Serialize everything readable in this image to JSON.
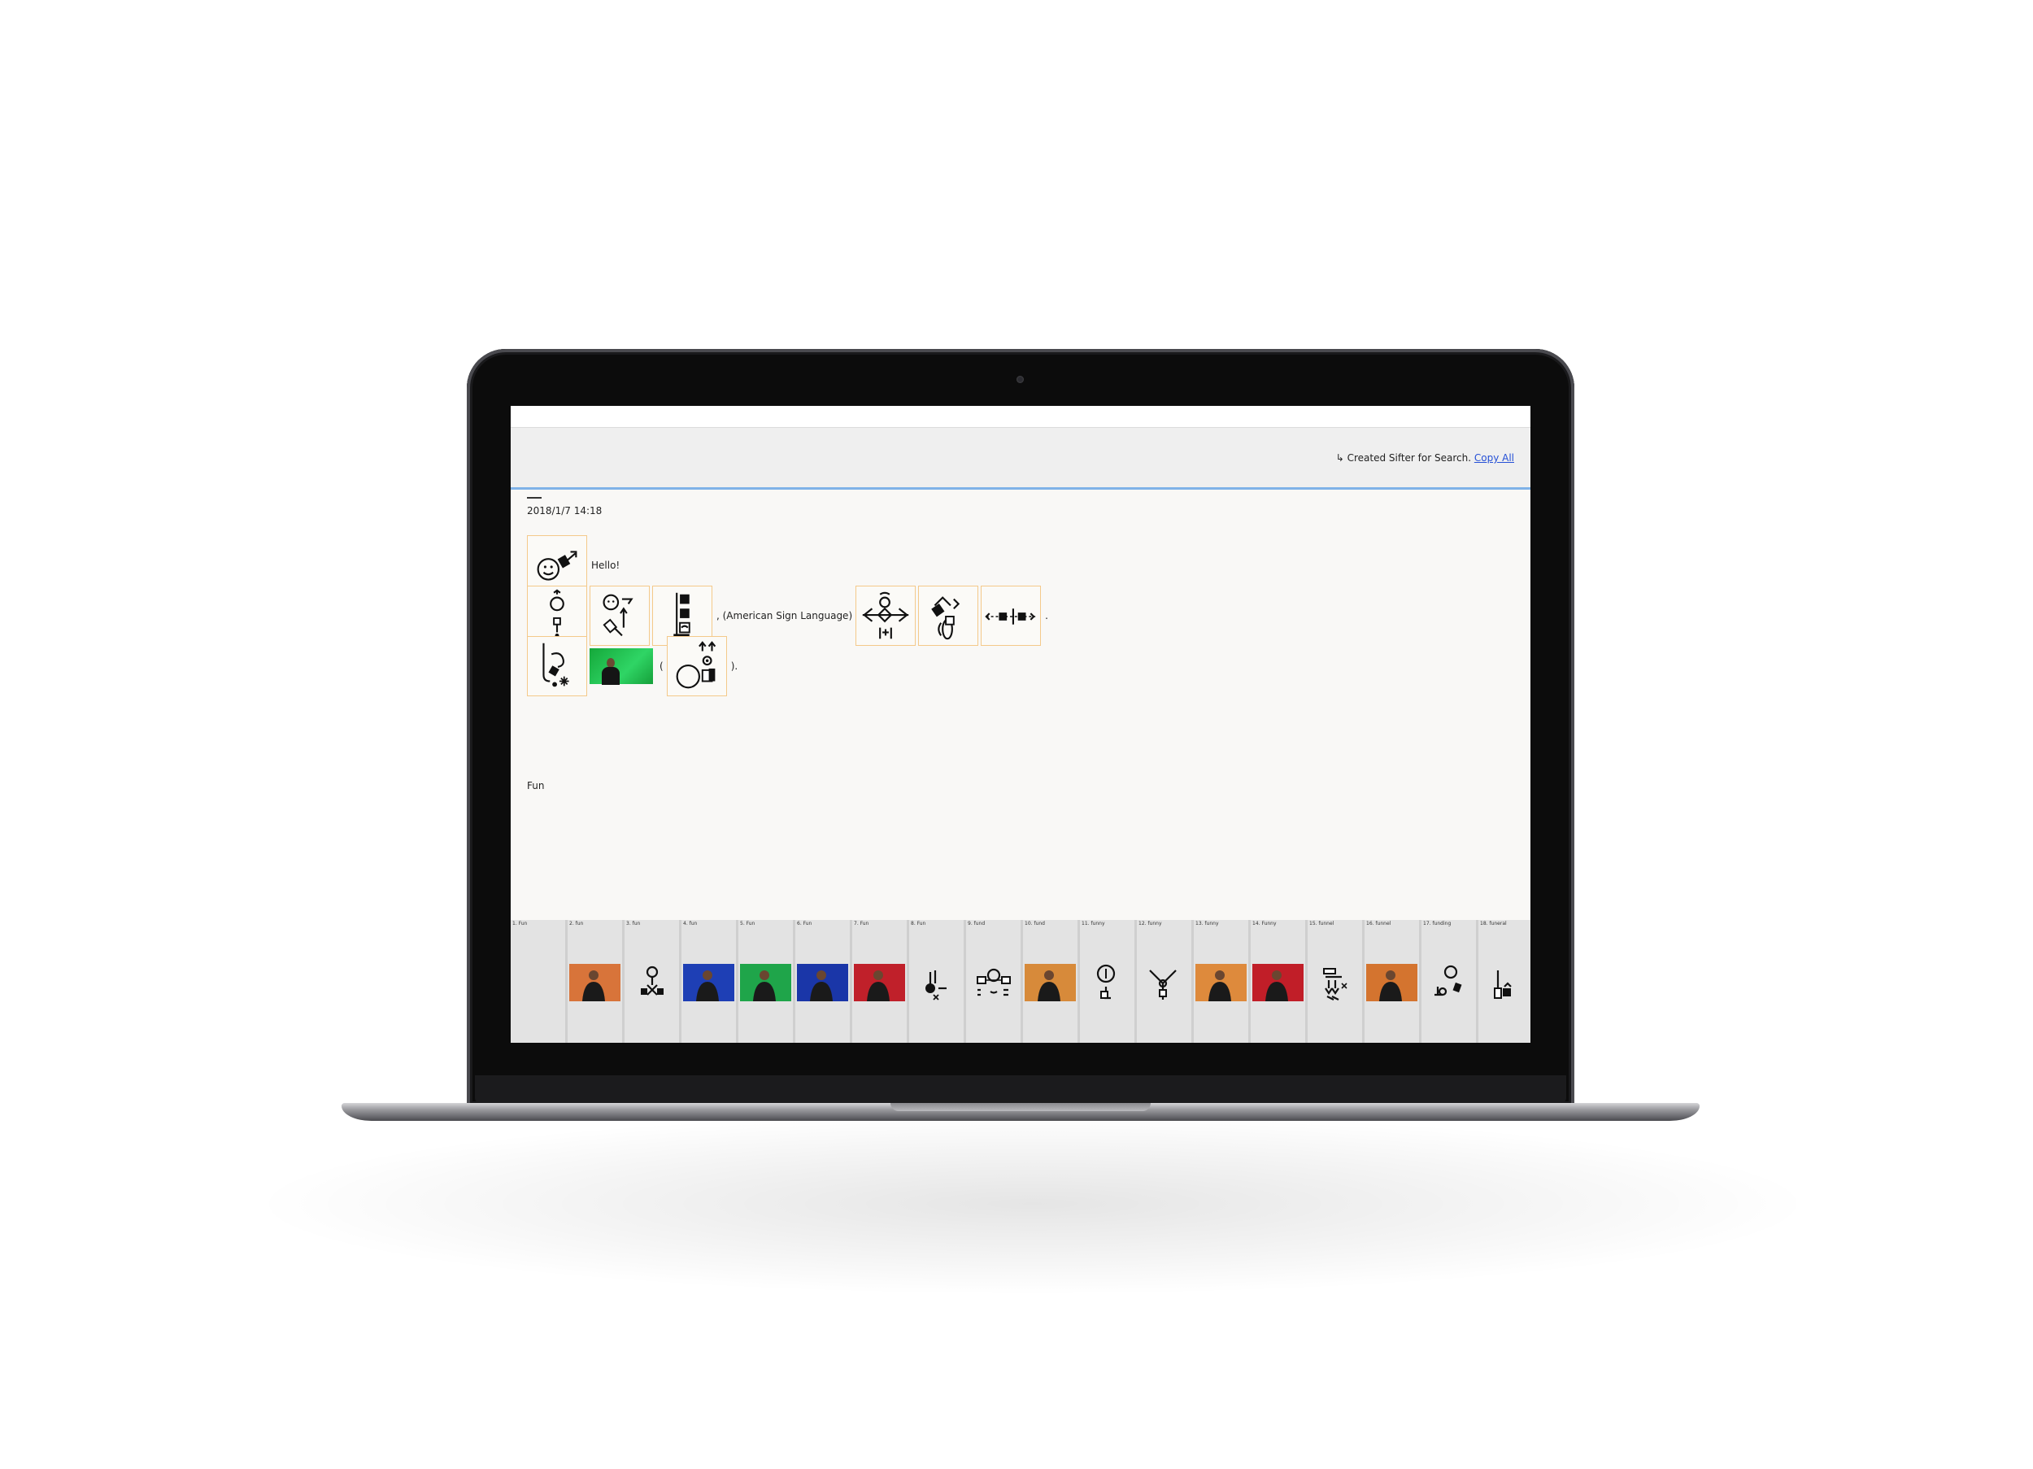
{
  "header": {
    "message": "↳ Created Sifter for Search. ",
    "copy_all_label": "Copy All"
  },
  "post": {
    "date": "2018/1/7 14:18",
    "rows": [
      {
        "items": [
          {
            "kind": "sign",
            "icon": "face-hand-sign-icon"
          },
          {
            "kind": "text",
            "text": "Hello!"
          }
        ]
      },
      {
        "items": [
          {
            "kind": "sign",
            "icon": "head-movement-sign-icon"
          },
          {
            "kind": "sign",
            "icon": "face-arrow-sign-icon"
          },
          {
            "kind": "sign",
            "icon": "bar-squares-sign-icon"
          },
          {
            "kind": "text",
            "text": ", (American Sign Language)"
          },
          {
            "kind": "sign",
            "icon": "branch-sign-icon"
          },
          {
            "kind": "sign",
            "icon": "twist-sign-icon"
          },
          {
            "kind": "sign",
            "icon": "line-arrows-sign-icon"
          },
          {
            "kind": "text",
            "text": "."
          }
        ]
      },
      {
        "items": [
          {
            "kind": "sign",
            "icon": "bend-star-sign-icon"
          },
          {
            "kind": "video",
            "icon": "video-green-thumb"
          },
          {
            "kind": "text",
            "text": "("
          },
          {
            "kind": "sign",
            "icon": "circle-arrows-sign-icon"
          },
          {
            "kind": "text",
            "text": ")."
          }
        ]
      }
    ],
    "label": "Fun"
  },
  "results": [
    {
      "label": "1. Fun",
      "type": "empty"
    },
    {
      "label": "2. fun",
      "type": "video",
      "bg": "#d8743a"
    },
    {
      "label": "3. fun",
      "type": "sign"
    },
    {
      "label": "4. fun",
      "type": "video",
      "bg": "#1e3fb5"
    },
    {
      "label": "5. Fun",
      "type": "video",
      "bg": "#1fa54a"
    },
    {
      "label": "6. Fun",
      "type": "video",
      "bg": "#1a36a8"
    },
    {
      "label": "7. Fun",
      "type": "video",
      "bg": "#c0202a"
    },
    {
      "label": "8. Fun",
      "type": "sign"
    },
    {
      "label": "9. fund",
      "type": "sign"
    },
    {
      "label": "10. fund",
      "type": "video",
      "bg": "#d78a3a"
    },
    {
      "label": "11. funny",
      "type": "sign"
    },
    {
      "label": "12. funny",
      "type": "sign"
    },
    {
      "label": "13. funny",
      "type": "video",
      "bg": "#de8a3c"
    },
    {
      "label": "14. Funny",
      "type": "video",
      "bg": "#c11e28"
    },
    {
      "label": "15. funnel",
      "type": "sign"
    },
    {
      "label": "16. funnel",
      "type": "video",
      "bg": "#d4742f"
    },
    {
      "label": "17. funding",
      "type": "sign"
    },
    {
      "label": "18. funeral",
      "type": "sign"
    }
  ]
}
